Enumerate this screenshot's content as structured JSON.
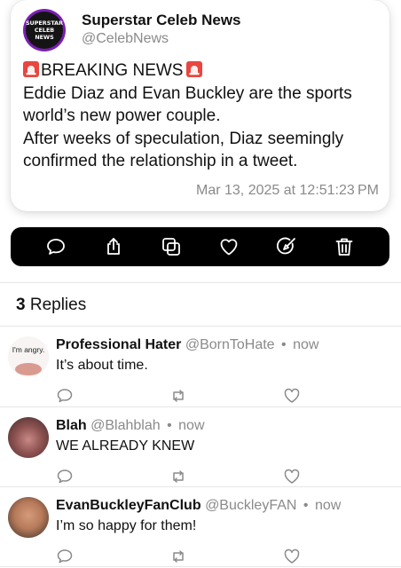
{
  "tweet": {
    "avatar_lines": [
      "SUPERSTAR",
      "CELEB",
      "NEWS"
    ],
    "author_name": "Superstar Celeb News",
    "author_handle": "@CelebNews",
    "headline": "BREAKING NEWS",
    "lines": [
      "Eddie Diaz and Evan Buckley are the sports",
      "world’s new power couple.",
      "After weeks of speculation, Diaz seemingly",
      "confirmed the relationship in a tweet."
    ],
    "timestamp": "Mar 13, 2025 at 12:51:23 PM"
  },
  "actions": [
    {
      "name": "reply",
      "icon": "speech-bubble-icon"
    },
    {
      "name": "share",
      "icon": "share-icon"
    },
    {
      "name": "copy",
      "icon": "copy-icon"
    },
    {
      "name": "like",
      "icon": "heart-icon"
    },
    {
      "name": "edit",
      "icon": "compass-edit-icon"
    },
    {
      "name": "delete",
      "icon": "trash-icon"
    }
  ],
  "replies_header": {
    "count": "3",
    "label": "Replies"
  },
  "replies": [
    {
      "name": "Professional Hater",
      "handle": "@BornToHate",
      "time": "now",
      "text": "It’s about time.",
      "avatar_text": "I'm angry."
    },
    {
      "name": "Blah",
      "handle": "@Blahblah",
      "time": "now",
      "text": "WE ALREADY KNEW"
    },
    {
      "name": "EvanBuckleyFanClub",
      "handle": "@BuckleyFAN",
      "time": "now",
      "text": "I’m so happy for them!"
    }
  ],
  "colors": {
    "action_bar_bg": "#000000",
    "secondary_text": "#8a8a8a",
    "avatar_ring": "#7a1fb0"
  }
}
